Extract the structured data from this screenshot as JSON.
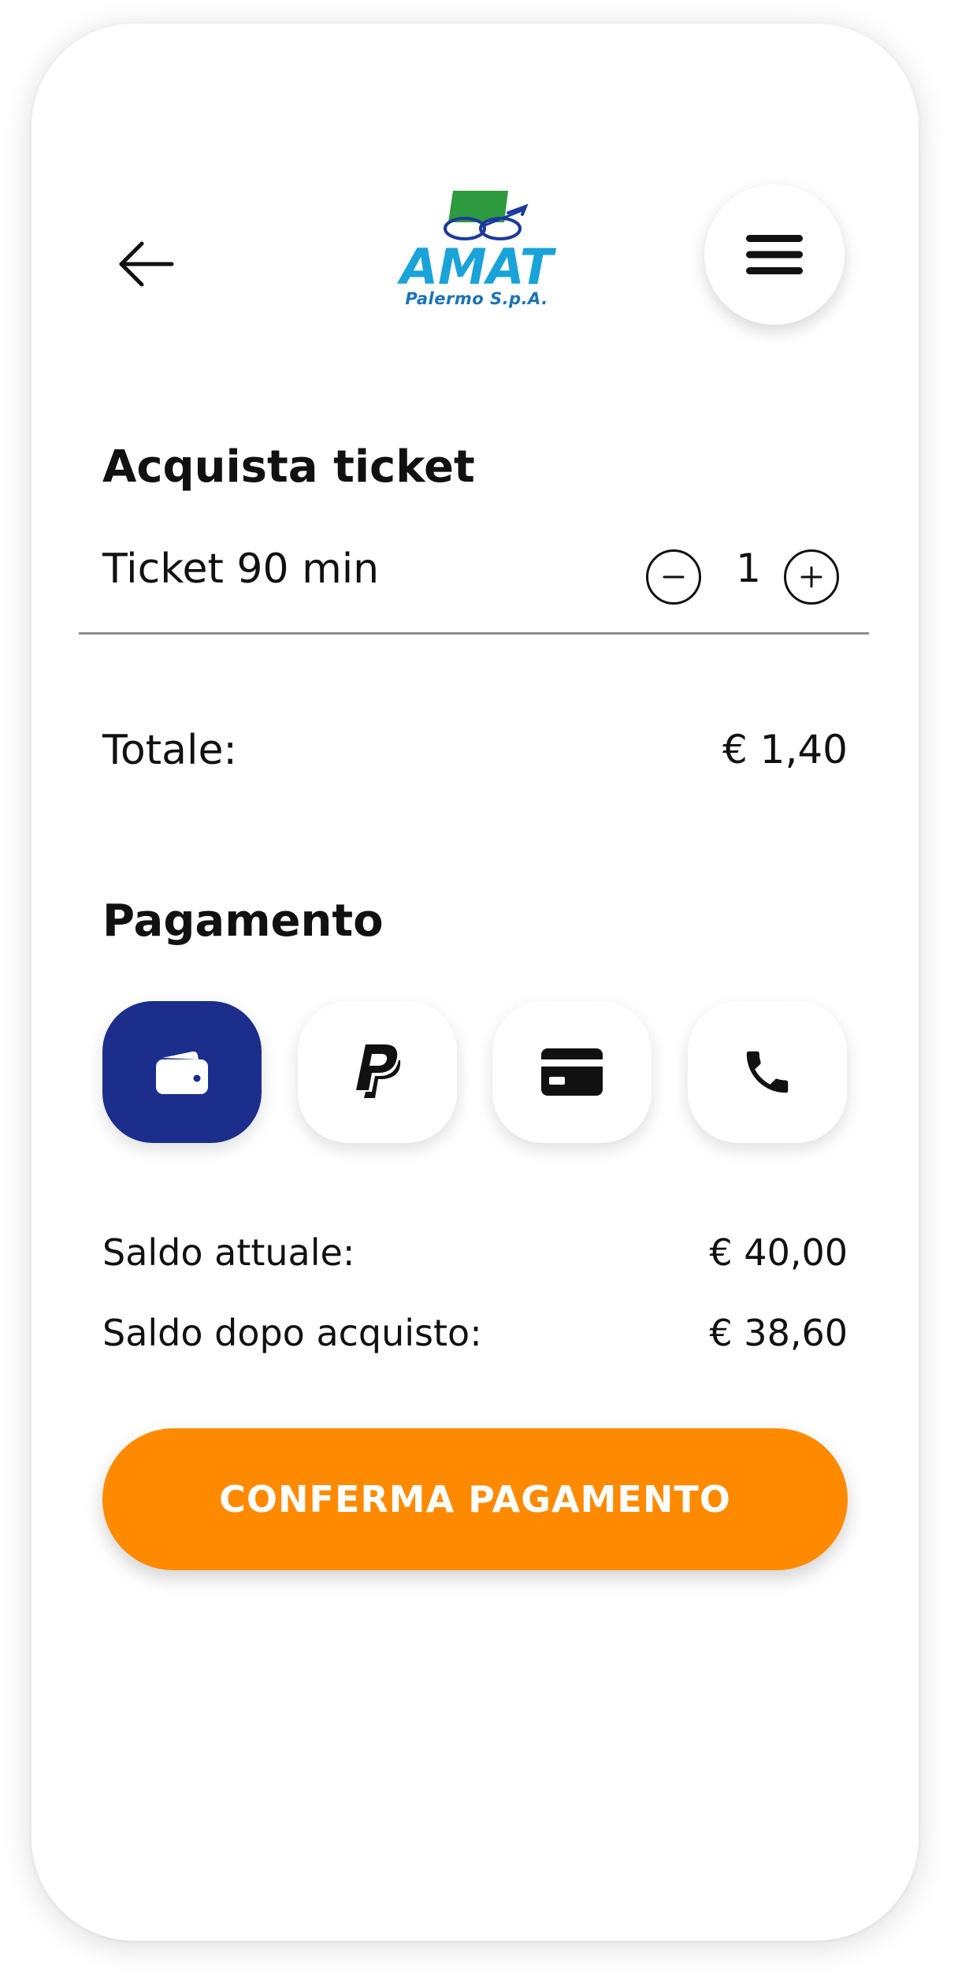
{
  "header": {
    "logo_text": "AMAT",
    "logo_subtitle": "Palermo S.p.A."
  },
  "purchase": {
    "title": "Acquista ticket",
    "ticket_label": "Ticket 90 min",
    "quantity": "1"
  },
  "total": {
    "label": "Totale:",
    "value": "€ 1,40"
  },
  "payment": {
    "title": "Pagamento",
    "methods": [
      {
        "icon": "wallet-icon",
        "selected": true
      },
      {
        "icon": "paypal-icon",
        "selected": false
      },
      {
        "icon": "credit-card-icon",
        "selected": false
      },
      {
        "icon": "phone-icon",
        "selected": false
      }
    ],
    "balance_label": "Saldo attuale:",
    "balance_value": "€ 40,00",
    "after_label": "Saldo dopo acquisto:",
    "after_value": "€ 38,60"
  },
  "confirm": {
    "label": "CONFERMA PAGAMENTO"
  },
  "colors": {
    "accent": "#ff8a00",
    "selected": "#1b2e8c",
    "logo_green": "#2e9a3f",
    "logo_blue": "#1a73b8",
    "logo_navy": "#1b3a9a"
  }
}
